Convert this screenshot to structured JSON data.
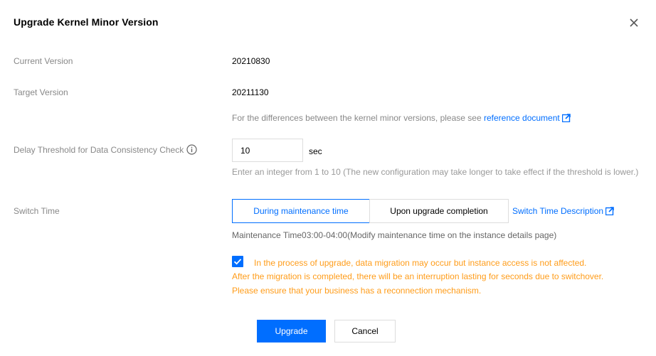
{
  "dialog": {
    "title": "Upgrade Kernel Minor Version"
  },
  "current_version": {
    "label": "Current Version",
    "value": "20210830"
  },
  "target_version": {
    "label": "Target Version",
    "value": "20211130",
    "hint_prefix": "For the differences between the kernel minor versions, please see ",
    "hint_link": "reference document"
  },
  "delay_threshold": {
    "label": "Delay Threshold for Data Consistency Check",
    "value": "10",
    "unit": "sec",
    "hint": "Enter an integer from 1 to 10 (The new configuration may take longer to take effect if the threshold is lower.)"
  },
  "switch_time": {
    "label": "Switch Time",
    "options": [
      "During maintenance time",
      "Upon upgrade completion"
    ],
    "selected": "During maintenance time",
    "description_link": "Switch Time Description",
    "maintenance_note": "Maintenance Time03:00-04:00(Modify maintenance time on the instance details page)"
  },
  "acknowledge": {
    "checked": true,
    "line1": "In the process of upgrade, data migration may occur but instance access is not affected.",
    "line2": "After the migration is completed, there will be an interruption lasting for seconds due to switchover. Please ensure that your business has a reconnection mechanism."
  },
  "footer": {
    "upgrade_label": "Upgrade",
    "cancel_label": "Cancel"
  },
  "colors": {
    "accent": "#006eff",
    "warning": "#ff9c19",
    "label_gray": "#888888"
  },
  "icons": [
    "close-icon",
    "info-icon",
    "external-link-icon",
    "checkmark-icon"
  ]
}
